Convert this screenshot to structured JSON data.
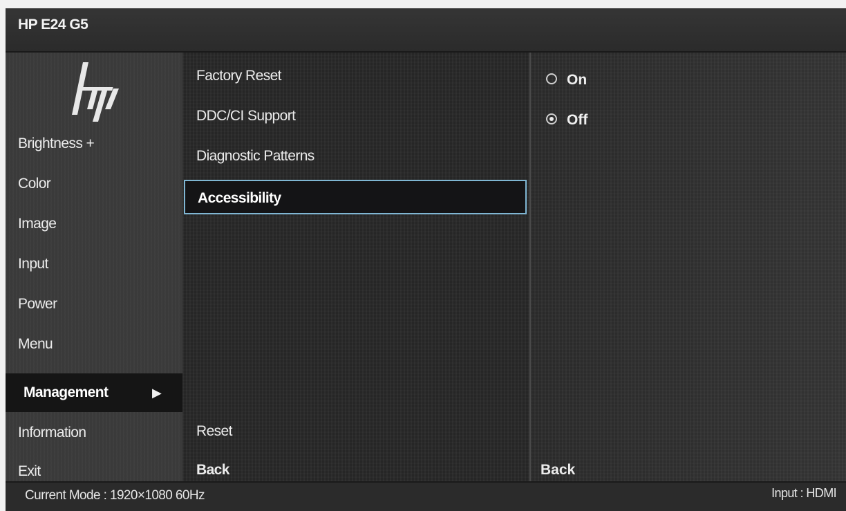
{
  "title": "HP E24 G5",
  "logo": "hp-logo",
  "nav": {
    "items": [
      {
        "label": "Brightness +",
        "name": "nav-item-brightness"
      },
      {
        "label": "Color",
        "name": "nav-item-color"
      },
      {
        "label": "Image",
        "name": "nav-item-image"
      },
      {
        "label": "Input",
        "name": "nav-item-input"
      },
      {
        "label": "Power",
        "name": "nav-item-power"
      },
      {
        "label": "Menu",
        "name": "nav-item-menu"
      },
      {
        "label": "Management",
        "name": "nav-item-management",
        "active": true,
        "arrow": "▶"
      },
      {
        "label": "Information",
        "name": "nav-item-information"
      },
      {
        "label": "Exit",
        "name": "nav-item-exit"
      }
    ]
  },
  "submenu": {
    "items": [
      {
        "label": "Factory Reset"
      },
      {
        "label": "DDC/CI Support"
      },
      {
        "label": "Diagnostic Patterns"
      },
      {
        "label": "Accessibility",
        "selected": true
      }
    ],
    "reset_label": "Reset",
    "back_label": "Back"
  },
  "options": {
    "items": [
      {
        "label": "On",
        "checked": false
      },
      {
        "label": "Off",
        "checked": true
      }
    ],
    "back_label": "Back"
  },
  "status": {
    "mode": "Current Mode : 1920×1080  60Hz",
    "input": "Input : HDMI"
  },
  "colors": {
    "selection_border": "#7fb6d3",
    "active_nav_bg": "#151515"
  }
}
